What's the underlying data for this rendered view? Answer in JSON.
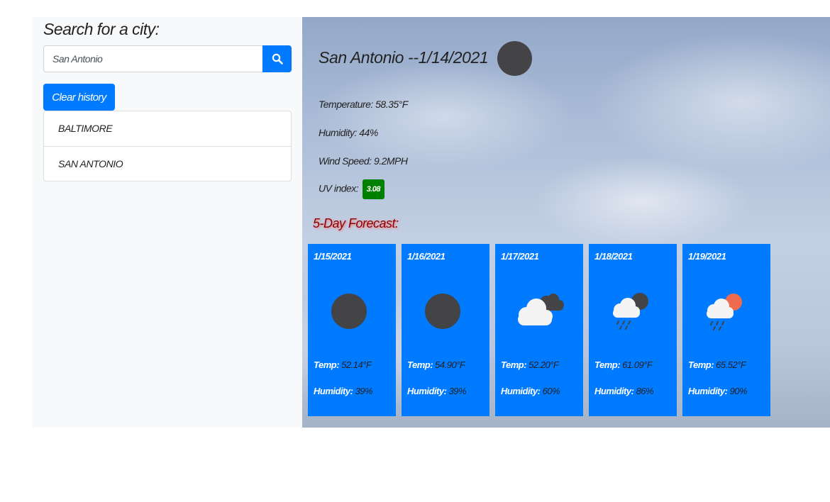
{
  "search": {
    "title": "Search for a city:",
    "value": "San Antonio",
    "button_icon": "search-icon"
  },
  "clear_label": "Clear history",
  "history": [
    "BALTIMORE",
    "SAN ANTONIO"
  ],
  "current": {
    "title": "San Antonio --1/14/2021",
    "icon": "dark-circle-icon",
    "temperature_label": "Temperature:",
    "temperature_value": "58.35°F",
    "humidity_label": "Humidity:",
    "humidity_value": "44%",
    "wind_label": "Wind Speed:",
    "wind_value": "9.2MPH",
    "uv_label": "UV index:",
    "uv_value": "3.08",
    "uv_color": "#008000"
  },
  "forecast_title": "5-Day Forecast:",
  "temp_label": "Temp:",
  "humidity_label": "Humidity:",
  "forecast": [
    {
      "date": "1/15/2021",
      "icon": "dark-circle-icon",
      "temp": "52.14°F",
      "humidity": "39%"
    },
    {
      "date": "1/16/2021",
      "icon": "dark-circle-icon",
      "temp": "54.90°F",
      "humidity": "39%"
    },
    {
      "date": "1/17/2021",
      "icon": "cloudy-icon",
      "temp": "52.20°F",
      "humidity": "60%"
    },
    {
      "date": "1/18/2021",
      "icon": "rain-night-icon",
      "temp": "61.09°F",
      "humidity": "86%"
    },
    {
      "date": "1/19/2021",
      "icon": "rain-sun-icon",
      "temp": "65.52°F",
      "humidity": "90%"
    }
  ],
  "colors": {
    "accent": "#007bff",
    "panel": "#f8f9fa",
    "forecast_title": "#8b0000"
  }
}
